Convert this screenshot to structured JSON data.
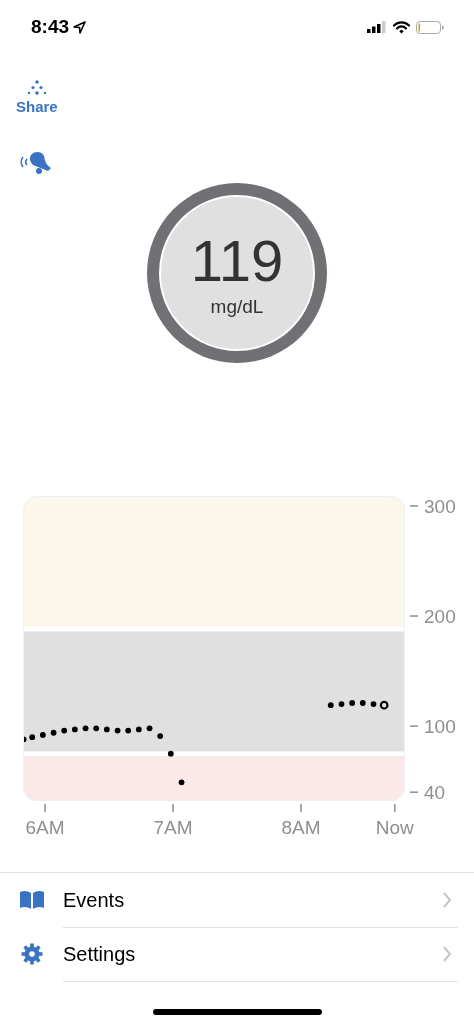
{
  "status_bar": {
    "time": "8:43"
  },
  "share_button": {
    "label": "Share"
  },
  "reading": {
    "value": "119",
    "unit": "mg/dL"
  },
  "graph": {
    "chart_data": {
      "type": "scatter",
      "x": [
        5.833,
        5.9,
        5.983,
        6.067,
        6.15,
        6.233,
        6.317,
        6.4,
        6.483,
        6.567,
        6.65,
        6.733,
        6.817,
        6.9,
        6.983,
        7.067,
        8.233,
        8.317,
        8.4,
        8.483,
        8.567,
        8.65
      ],
      "series": [
        {
          "color": "#000000",
          "marker": "circle",
          "values": [
            88,
            90,
            92,
            94,
            96,
            97,
            98,
            98,
            97,
            96,
            96,
            97,
            98,
            91,
            75,
            49,
            119,
            120,
            121,
            121,
            120,
            null
          ]
        },
        {
          "color": "#000000",
          "marker": "circle",
          "values": [
            null,
            null,
            null,
            null,
            null,
            null,
            null,
            null,
            null,
            null,
            null,
            null,
            null,
            null,
            null,
            null,
            null,
            null,
            null,
            null,
            null,
            119
          ]
        }
      ],
      "xlim": [
        5.828,
        8.813
      ],
      "ylim": [
        32,
        309
      ],
      "bands": [
        {
          "axis": "y",
          "from": 190,
          "to": 309,
          "color": "#fbf8eb"
        },
        {
          "axis": "y",
          "from": 77,
          "to": 186,
          "color": "#e0e0e0"
        },
        {
          "axis": "y",
          "from": 32,
          "to": 73,
          "color": "#fbe9e9"
        }
      ],
      "xticks": [
        {
          "value": 6,
          "label": "6AM"
        },
        {
          "value": 7,
          "label": "7AM"
        },
        {
          "value": 8,
          "label": "8AM"
        },
        {
          "value": 8.733,
          "label": "Now"
        }
      ],
      "yticks": [
        300,
        200,
        100,
        40
      ]
    }
  },
  "menu": [
    {
      "kind": "book",
      "label": "Events"
    },
    {
      "kind": "gear",
      "label": "Settings"
    }
  ]
}
